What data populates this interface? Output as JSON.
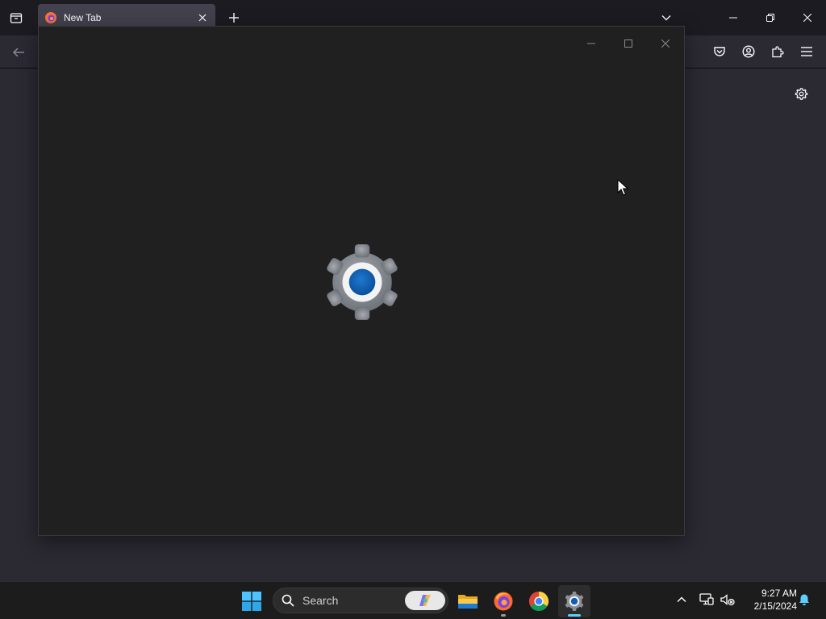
{
  "browser": {
    "tab": {
      "title": "New Tab"
    },
    "icons": {
      "tab_overview": "folder-tabs-icon",
      "new_tab": "plus-icon",
      "tab_list": "chevron-down-icon",
      "back": "arrow-left-icon",
      "pocket": "pocket-icon",
      "account": "account-icon",
      "extensions": "puzzle-icon",
      "menu": "hamburger-icon",
      "page_settings": "gear-icon"
    }
  },
  "settings_window": {
    "splash_icon": "settings-gear-icon",
    "colors": {
      "gear": "#8a8e94",
      "center": "#0f5fb5"
    }
  },
  "taskbar": {
    "search": {
      "label": "Search"
    },
    "apps": [
      "start-icon",
      "file-explorer-icon",
      "firefox-icon",
      "chrome-icon",
      "settings-icon"
    ],
    "clock": {
      "time": "9:27 AM",
      "date": "2/15/2024"
    },
    "accent": "#60cdff"
  }
}
